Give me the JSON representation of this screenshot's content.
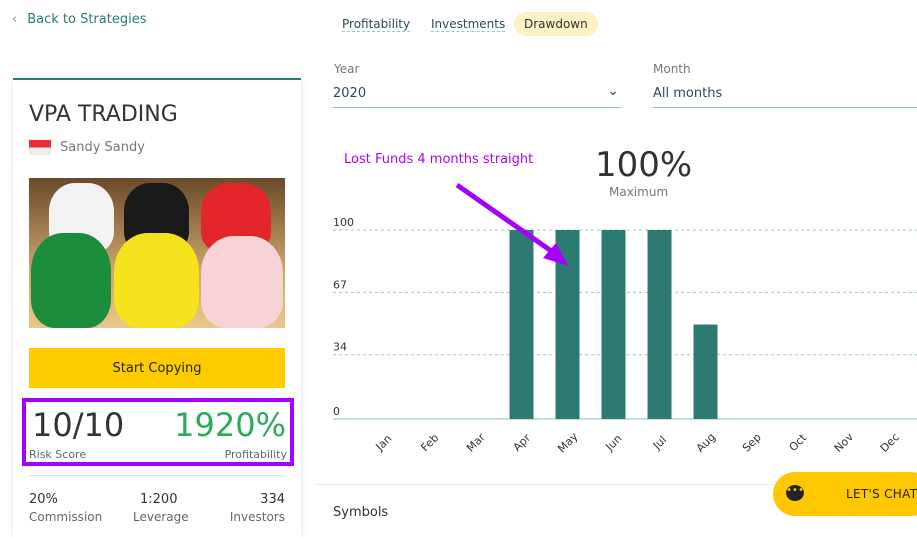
{
  "nav": {
    "back_label": "Back to Strategies"
  },
  "strategy": {
    "title": "VPA TRADING",
    "author": "Sandy Sandy",
    "start_label": "Start Copying",
    "risk_score": "10/10",
    "risk_label": "Risk Score",
    "profitability": "1920%",
    "profitability_label": "Profitability",
    "stats": [
      {
        "value": "20%",
        "label": "Commission"
      },
      {
        "value": "1:200",
        "label": "Leverage"
      },
      {
        "value": "334",
        "label": "Investors"
      }
    ]
  },
  "tabs": [
    {
      "label": "Profitability"
    },
    {
      "label": "Investments"
    },
    {
      "label": "Drawdown",
      "active": true
    }
  ],
  "filters": {
    "year_label": "Year",
    "year_value": "2020",
    "month_label": "Month",
    "month_value": "All months"
  },
  "annotation": "Lost Funds 4 months straight",
  "summary": {
    "value": "100%",
    "label": "Maximum"
  },
  "chart_data": {
    "type": "bar",
    "categories": [
      "Jan",
      "Feb",
      "Mar",
      "Apr",
      "May",
      "Jun",
      "Jul",
      "Aug",
      "Sep",
      "Oct",
      "Nov",
      "Dec"
    ],
    "values": [
      0,
      0,
      0,
      100,
      100,
      100,
      100,
      50,
      0,
      0,
      0,
      0
    ],
    "yticks": [
      0,
      34,
      67,
      100
    ],
    "ylim": [
      0,
      100
    ],
    "grid": true,
    "color": "#2d7a72"
  },
  "symbols_label": "Symbols",
  "chat": {
    "label": "LET'S CHAT"
  },
  "colors": {
    "accent": "#2d7a72",
    "highlight": "#a600ff",
    "button": "#ffcc00",
    "profit": "#2eaa5b"
  }
}
